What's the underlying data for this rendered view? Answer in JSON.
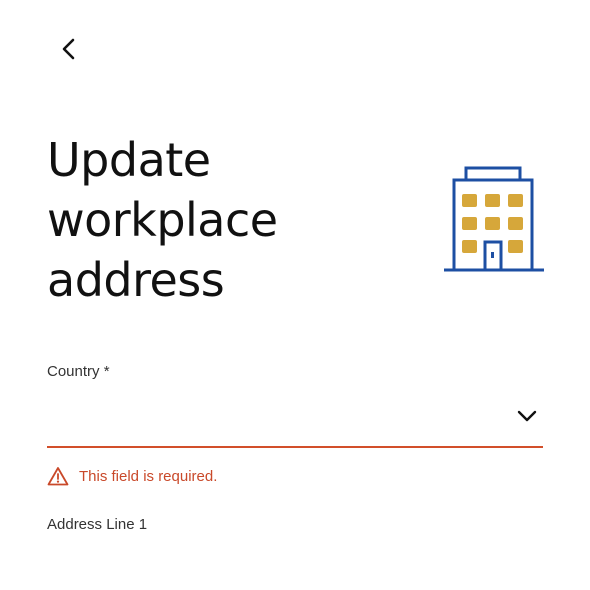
{
  "header": {
    "back_icon": "chevron-left-icon"
  },
  "page": {
    "title_lines": [
      "Update",
      "workplace",
      "address"
    ],
    "illustration": "building-icon"
  },
  "colors": {
    "error": "#c9492a",
    "building_outline": "#1d4fa3",
    "building_windows": "#d6a73a"
  },
  "form": {
    "country": {
      "label": "Country *",
      "value": "",
      "dropdown_icon": "chevron-down-icon",
      "error_icon": "warning-triangle-icon",
      "error": "This field is required."
    },
    "address_line_1": {
      "label": "Address Line 1"
    }
  }
}
